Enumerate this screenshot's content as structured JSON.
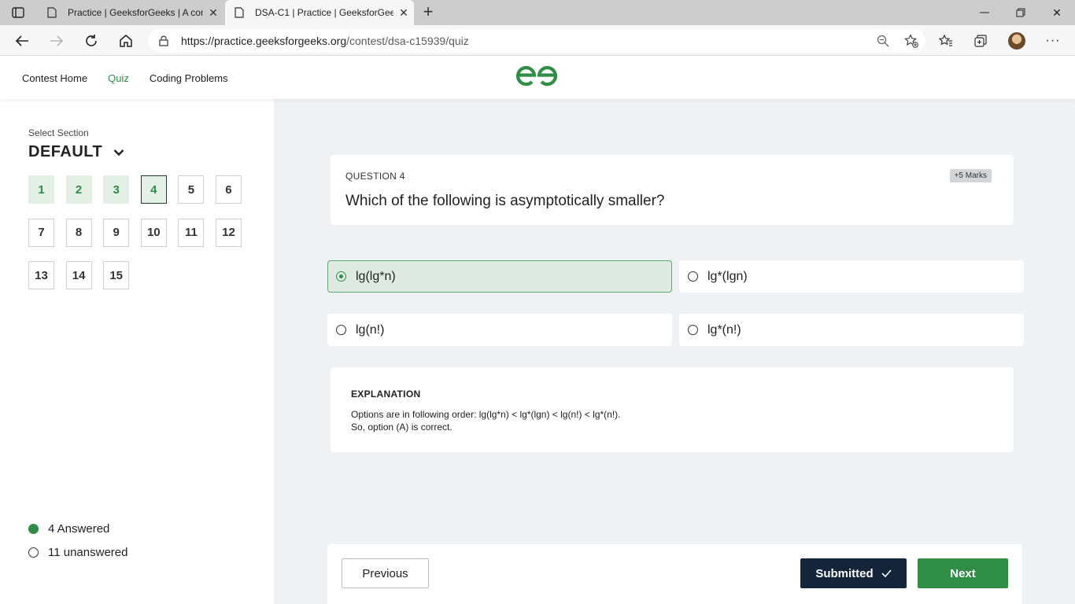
{
  "browser": {
    "tabs": [
      {
        "title": "Practice | GeeksforGeeks | A com",
        "active": false
      },
      {
        "title": "DSA-C1 | Practice | GeeksforGeeks",
        "active": true
      }
    ],
    "url_host": "https://practice.geeksforgeeks.org",
    "url_path": "/contest/dsa-c15939/quiz"
  },
  "site": {
    "nav": {
      "contest_home": "Contest Home",
      "quiz": "Quiz",
      "coding_problems": "Coding Problems"
    },
    "brand_color": "#2f8d46"
  },
  "sidebar": {
    "select_section_label": "Select Section",
    "section_value": "DEFAULT",
    "questions": [
      {
        "num": "1",
        "state": "answered"
      },
      {
        "num": "2",
        "state": "answered"
      },
      {
        "num": "3",
        "state": "answered"
      },
      {
        "num": "4",
        "state": "current"
      },
      {
        "num": "5",
        "state": "unanswered"
      },
      {
        "num": "6",
        "state": "unanswered"
      },
      {
        "num": "7",
        "state": "unanswered"
      },
      {
        "num": "8",
        "state": "unanswered"
      },
      {
        "num": "9",
        "state": "unanswered"
      },
      {
        "num": "10",
        "state": "unanswered"
      },
      {
        "num": "11",
        "state": "unanswered"
      },
      {
        "num": "12",
        "state": "unanswered"
      },
      {
        "num": "13",
        "state": "unanswered"
      },
      {
        "num": "14",
        "state": "unanswered"
      },
      {
        "num": "15",
        "state": "unanswered"
      }
    ],
    "answered_text": "4 Answered",
    "unanswered_text": "11 unanswered"
  },
  "question": {
    "label": "QUESTION 4",
    "marks": "+5 Marks",
    "text": "Which of the following is asymptotically smaller?",
    "options": [
      {
        "text": "lg(lg*n)",
        "selected": true
      },
      {
        "text": "lg*(lgn)",
        "selected": false
      },
      {
        "text": "lg(n!)",
        "selected": false
      },
      {
        "text": "lg*(n!)",
        "selected": false
      }
    ]
  },
  "explanation": {
    "title": "EXPLANATION",
    "line1": "Options are in following order: lg(lg*n) < lg*(lgn) < lg(n!) < lg*(n!).",
    "line2": "So, option (A) is correct."
  },
  "footer": {
    "previous": "Previous",
    "submitted": "Submitted",
    "next": "Next"
  }
}
